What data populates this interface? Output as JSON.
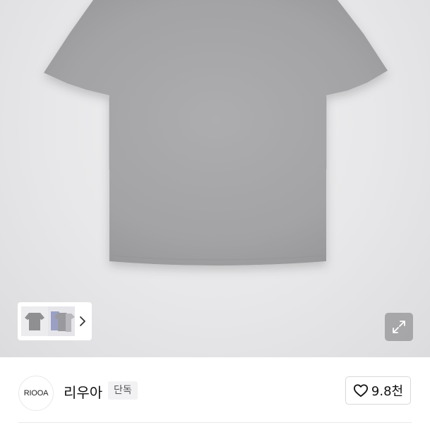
{
  "product": {
    "image_alt": "gray t-shirt",
    "thumbnails": [
      "gray-tshirt-front",
      "gray-tshirt-set"
    ]
  },
  "gallery": {
    "next_icon": "chevron-right-icon",
    "expand_icon": "expand-icon"
  },
  "brand": {
    "logo_text": "RIOOA",
    "name": "리우아",
    "badge": "단독"
  },
  "likes": {
    "icon": "heart-outline-icon",
    "count": "9.8천"
  }
}
